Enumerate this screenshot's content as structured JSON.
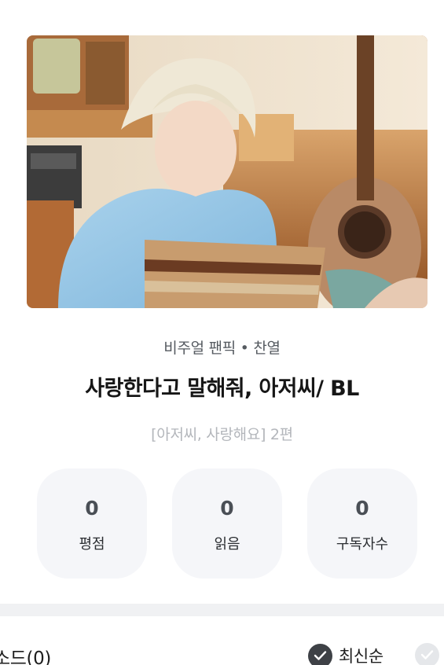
{
  "novel": {
    "category": "비주얼 팬픽 • 찬열",
    "title": "사랑한다고 말해줘, 아저씨/ BL",
    "subtitle": "[아저씨, 사랑해요] 2편"
  },
  "stats": [
    {
      "value": "0",
      "label": "평점"
    },
    {
      "value": "0",
      "label": "읽음"
    },
    {
      "value": "0",
      "label": "구독자수"
    }
  ],
  "episodes": {
    "label": "소드(0)",
    "sort_latest_label": "최신순"
  },
  "colors": {
    "stat_bg": "#f5f6f9",
    "divider": "#f0f1f3",
    "check_active": "#3e4146",
    "check_inactive": "#e5e7ea"
  },
  "icons": {
    "sort_latest": "check-circle-icon",
    "sort_other": "check-circle-icon"
  }
}
